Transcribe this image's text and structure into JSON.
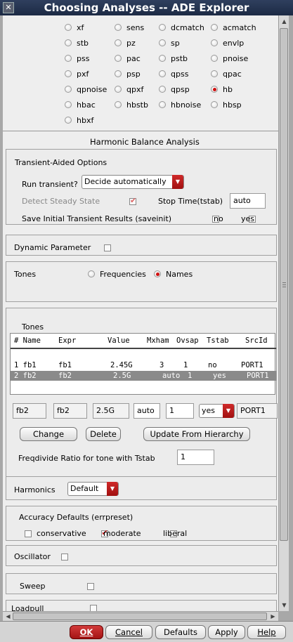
{
  "window": {
    "title": "Choosing Analyses -- ADE Explorer"
  },
  "analyses": [
    {
      "label": "xf",
      "selected": false
    },
    {
      "label": "sens",
      "selected": false
    },
    {
      "label": "dcmatch",
      "selected": false
    },
    {
      "label": "acmatch",
      "selected": false
    },
    {
      "label": "stb",
      "selected": false
    },
    {
      "label": "pz",
      "selected": false
    },
    {
      "label": "sp",
      "selected": false
    },
    {
      "label": "envlp",
      "selected": false
    },
    {
      "label": "pss",
      "selected": false
    },
    {
      "label": "pac",
      "selected": false
    },
    {
      "label": "pstb",
      "selected": false
    },
    {
      "label": "pnoise",
      "selected": false
    },
    {
      "label": "pxf",
      "selected": false
    },
    {
      "label": "psp",
      "selected": false
    },
    {
      "label": "qpss",
      "selected": false
    },
    {
      "label": "qpac",
      "selected": false
    },
    {
      "label": "qpnoise",
      "selected": false
    },
    {
      "label": "qpxf",
      "selected": false
    },
    {
      "label": "qpsp",
      "selected": false
    },
    {
      "label": "hb",
      "selected": true
    },
    {
      "label": "hbac",
      "selected": false
    },
    {
      "label": "hbstb",
      "selected": false
    },
    {
      "label": "hbnoise",
      "selected": false
    },
    {
      "label": "hbsp",
      "selected": false
    },
    {
      "label": "hbxf",
      "selected": false
    }
  ],
  "section_title": "Harmonic Balance Analysis",
  "transient": {
    "group_label": "Transient-Aided Options",
    "run_label": "Run transient?",
    "run_value": "Decide automatically",
    "detect_label": "Detect Steady State",
    "detect_checked": true,
    "stop_label": "Stop Time(tstab)",
    "stop_value": "auto",
    "save_label": "Save Initial Transient Results (saveinit)",
    "save_no": "no",
    "save_yes": "yes"
  },
  "dynamic": {
    "label": "Dynamic Parameter"
  },
  "tones": {
    "label": "Tones",
    "opt_frequencies": "Frequencies",
    "opt_names": "Names",
    "selected": "Names",
    "table_label": "Tones",
    "columns": [
      "# Name",
      "Expr",
      "Value",
      "Mxham",
      "Ovsap",
      "Tstab",
      "SrcId"
    ],
    "rows": [
      {
        "num_name": "1 fb1",
        "expr": "fb1",
        "value": "2.45G",
        "mxham": "3",
        "ovsap": "1",
        "tstab": "no",
        "srcid": "PORT1",
        "selected": false
      },
      {
        "num_name": "2 fb2",
        "expr": "fb2",
        "value": "2.5G",
        "mxham": "auto",
        "ovsap": "1",
        "tstab": "yes",
        "srcid": "PORT1",
        "selected": true
      }
    ],
    "edit": {
      "name": "fb2",
      "expr": "fb2",
      "value": "2.5G",
      "mxham": "auto",
      "ovsap": "1",
      "tstab": "yes",
      "srcid": "PORT1"
    },
    "change_btn": "Change",
    "delete_btn": "Delete",
    "update_btn": "Update From Hierarchy",
    "freqdivide_label": "Freqdivide Ratio for tone with Tstab",
    "freqdivide_value": "1"
  },
  "harmonics": {
    "label": "Harmonics",
    "value": "Default"
  },
  "accuracy": {
    "label": "Accuracy Defaults (errpreset)",
    "options": [
      {
        "label": "conservative",
        "checked": false
      },
      {
        "label": "moderate",
        "checked": true
      },
      {
        "label": "liberal",
        "checked": false
      }
    ]
  },
  "oscillator": {
    "label": "Oscillator"
  },
  "sweep": {
    "label": "Sweep"
  },
  "loadpull": {
    "label": "Loadpull"
  },
  "buttons": {
    "ok": "OK",
    "cancel": "Cancel",
    "defaults": "Defaults",
    "apply": "Apply",
    "help": "Help"
  }
}
